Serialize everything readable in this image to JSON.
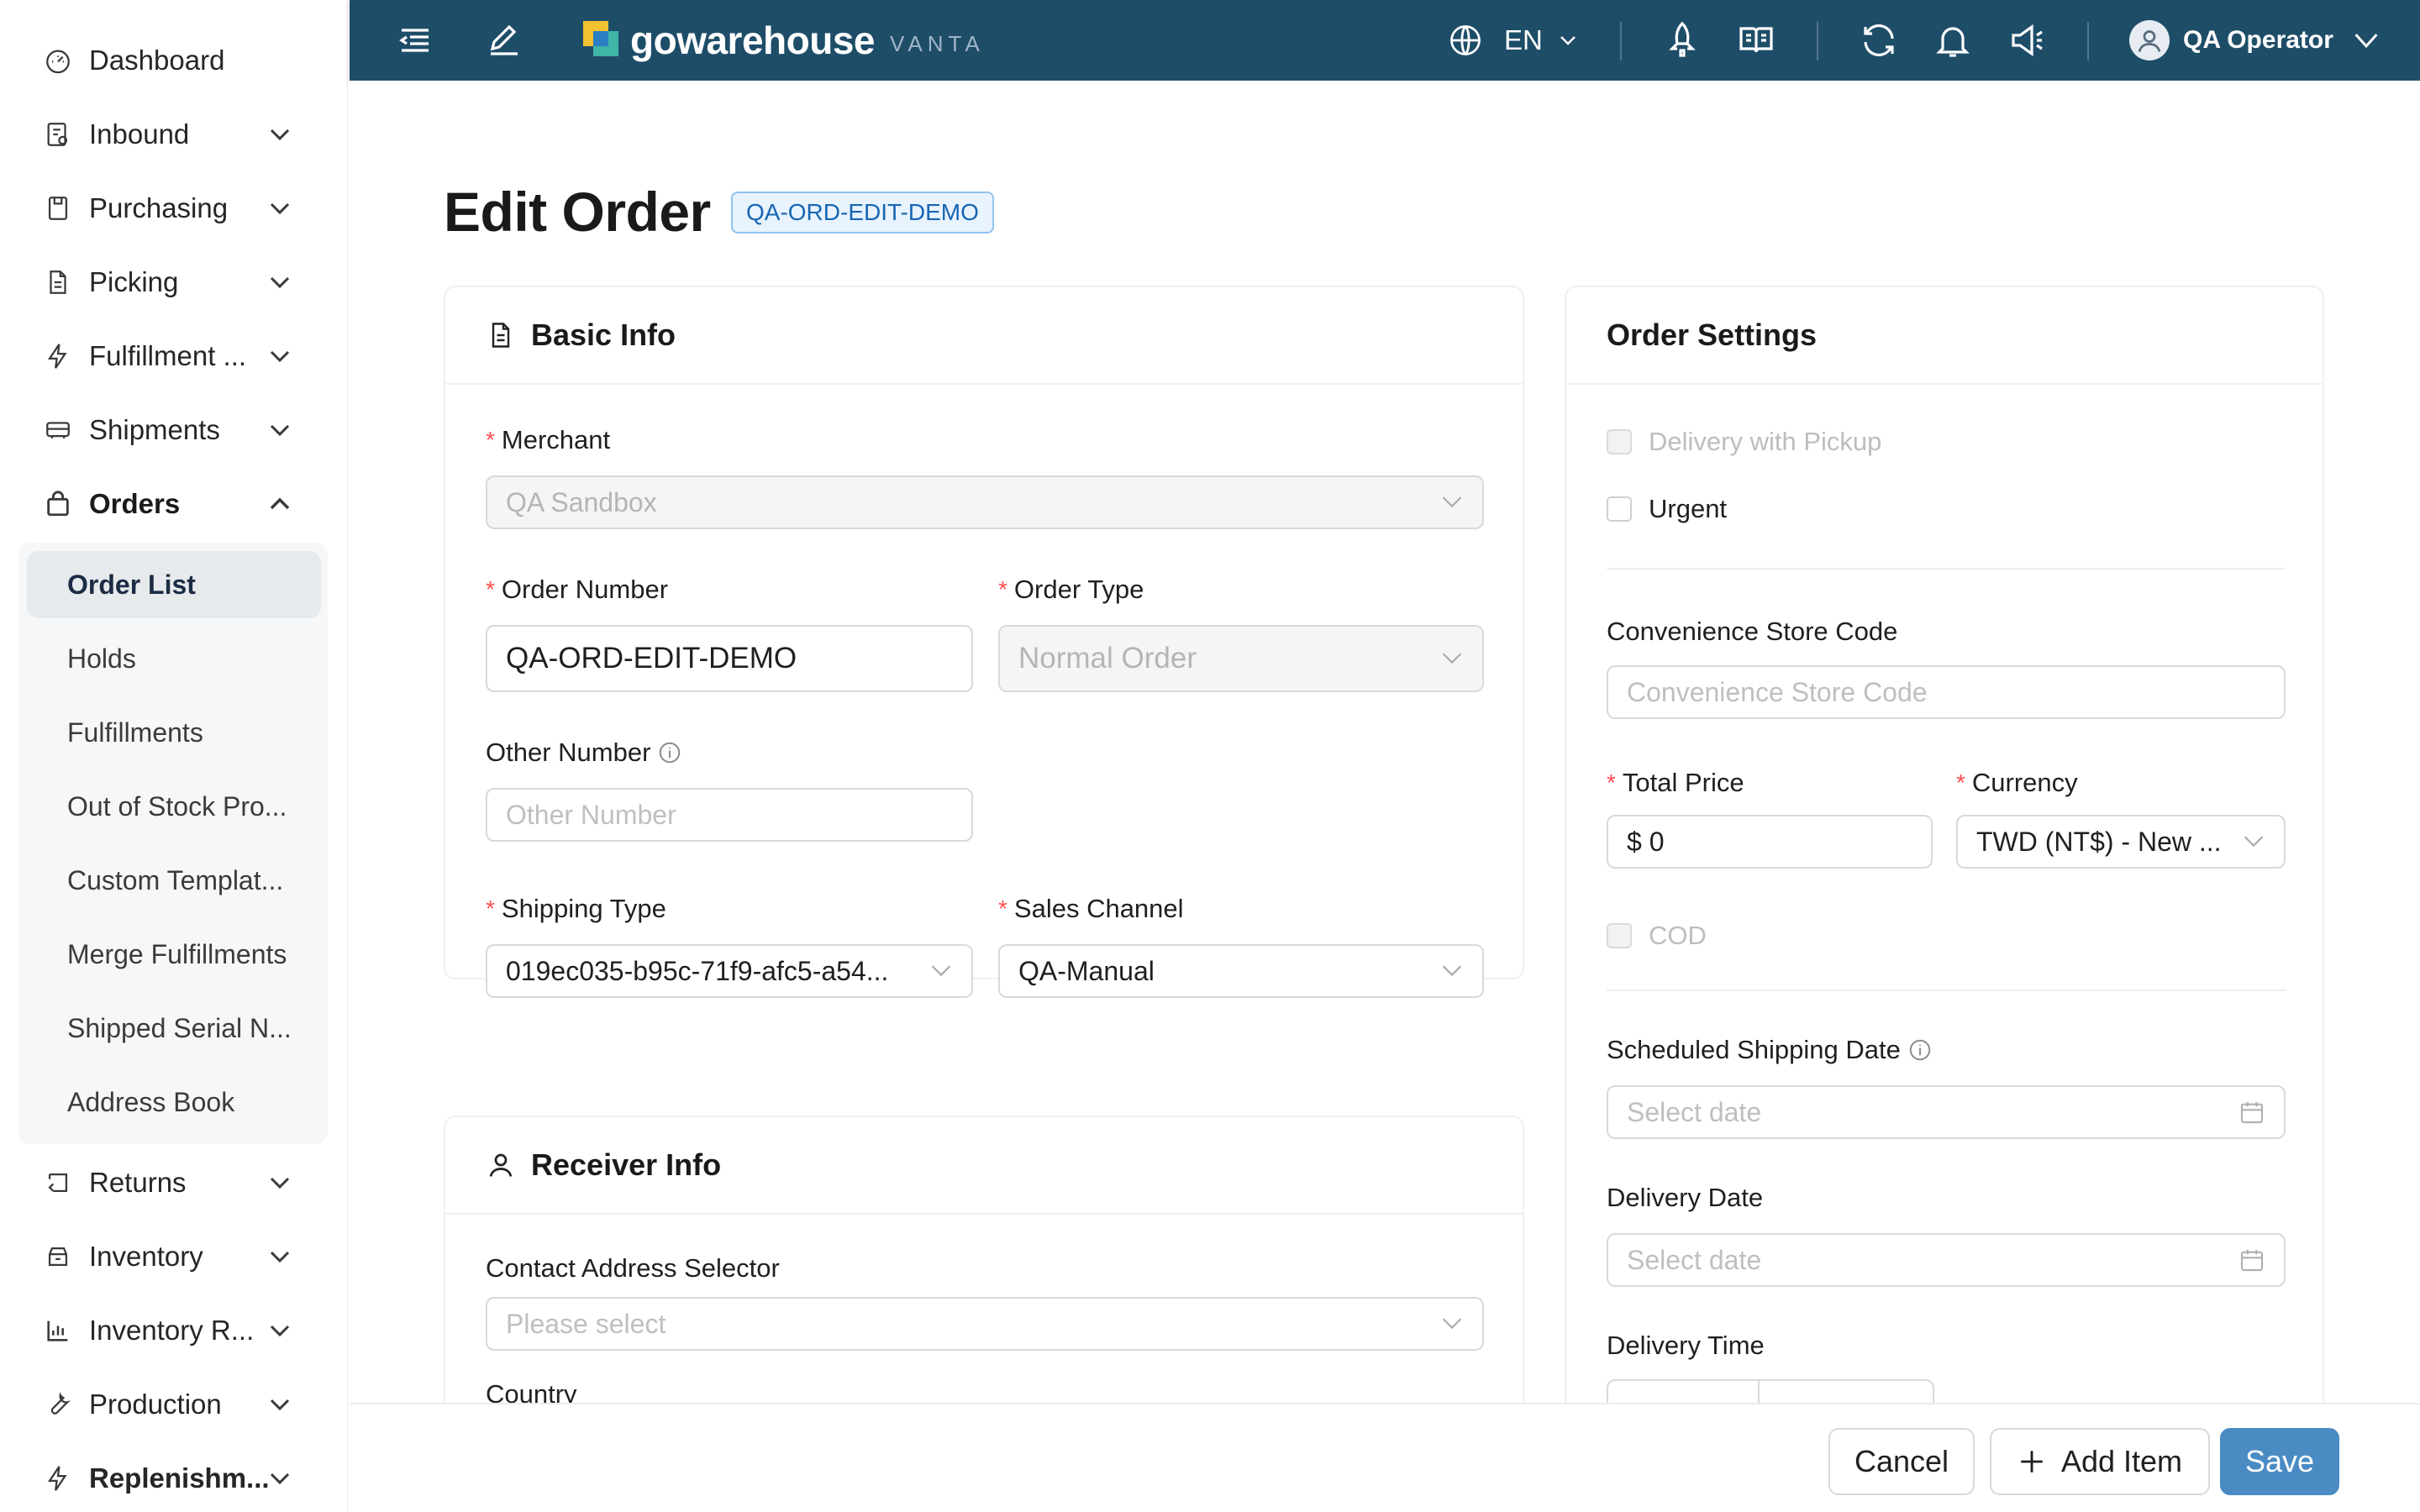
{
  "sidebar": {
    "items": [
      {
        "label": "Dashboard",
        "icon": "dashboard-icon"
      },
      {
        "label": "Inbound",
        "icon": "inbound-icon"
      },
      {
        "label": "Purchasing",
        "icon": "purchasing-icon"
      },
      {
        "label": "Picking",
        "icon": "picking-icon"
      },
      {
        "label": "Fulfillment ...",
        "icon": "lightning-icon"
      },
      {
        "label": "Shipments",
        "icon": "truck-icon"
      },
      {
        "label": "Orders",
        "icon": "bag-icon"
      },
      {
        "label": "Returns",
        "icon": "return-icon"
      },
      {
        "label": "Inventory",
        "icon": "inventory-icon"
      },
      {
        "label": "Inventory R...",
        "icon": "bar-chart-icon"
      },
      {
        "label": "Production",
        "icon": "wrench-icon"
      },
      {
        "label": "Replenishm...",
        "icon": "lightning-icon"
      }
    ],
    "orders_submenu": [
      "Order List",
      "Holds",
      "Fulfillments",
      "Out of Stock Pro...",
      "Custom Templat...",
      "Merge Fulfillments",
      "Shipped Serial N...",
      "Address Book"
    ]
  },
  "topbar": {
    "brand_name": "gowarehouse",
    "brand_sub": "VANTA",
    "language": "EN",
    "user_name": "QA Operator"
  },
  "page": {
    "title": "Edit Order",
    "order_badge": "QA-ORD-EDIT-DEMO"
  },
  "basic_info": {
    "title": "Basic Info",
    "merchant_label": "Merchant",
    "merchant_value": "QA Sandbox",
    "order_number_label": "Order Number",
    "order_number_value": "QA-ORD-EDIT-DEMO",
    "order_type_label": "Order Type",
    "order_type_value": "Normal Order",
    "other_number_label": "Other Number",
    "other_number_placeholder": "Other Number",
    "shipping_type_label": "Shipping Type",
    "shipping_type_value": "019ec035-b95c-71f9-afc5-a54...",
    "sales_channel_label": "Sales Channel",
    "sales_channel_value": "QA-Manual"
  },
  "receiver_info": {
    "title": "Receiver Info",
    "contact_selector_label": "Contact Address Selector",
    "contact_selector_placeholder": "Please select",
    "country_label": "Country"
  },
  "order_settings": {
    "title": "Order Settings",
    "delivery_with_pickup_label": "Delivery with Pickup",
    "urgent_label": "Urgent",
    "store_code_label": "Convenience Store Code",
    "store_code_placeholder": "Convenience Store Code",
    "total_price_label": "Total Price",
    "total_price_value": "$ 0",
    "currency_label": "Currency",
    "currency_value": "TWD (NT$) - New ...",
    "cod_label": "COD",
    "scheduled_shipping_label": "Scheduled Shipping Date",
    "scheduled_shipping_placeholder": "Select date",
    "delivery_date_label": "Delivery Date",
    "delivery_date_placeholder": "Select date",
    "delivery_time_label": "Delivery Time"
  },
  "actions": {
    "cancel": "Cancel",
    "add_item": "Add Item",
    "save": "Save"
  },
  "colors": {
    "topbar_bg": "#1e4d68",
    "primary": "#4a8bc4",
    "required": "#ff4d4f",
    "badge_text": "#1766b3"
  }
}
